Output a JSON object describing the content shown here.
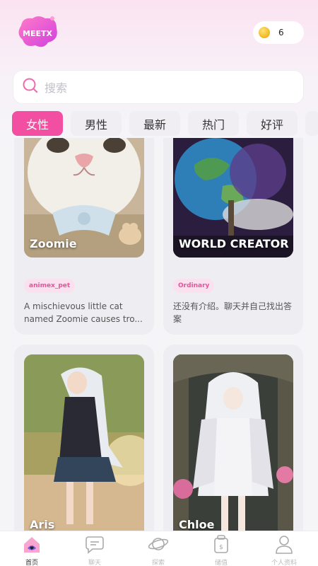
{
  "header": {
    "logo_text": "MEETX",
    "coin_count": "6"
  },
  "search": {
    "placeholder": "搜索"
  },
  "tabs": [
    {
      "label": "女性",
      "active": true
    },
    {
      "label": "男性",
      "active": false
    },
    {
      "label": "最新",
      "active": false
    },
    {
      "label": "热门",
      "active": false
    },
    {
      "label": "好评",
      "active": false
    }
  ],
  "cards": [
    {
      "title": "Zoomie",
      "tag": "animex_pet",
      "description": "A mischievous little cat named Zoomie causes tro..."
    },
    {
      "title": "WORLD CREATOR",
      "tag": "Ordinary",
      "description": "还没有介绍。聊天并自己找出答案"
    },
    {
      "title": "Aris"
    },
    {
      "title": "Chloe"
    }
  ],
  "bottom_nav": [
    {
      "label": "首页",
      "icon": "home-icon",
      "active": true
    },
    {
      "label": "聊天",
      "icon": "chat-icon",
      "active": false
    },
    {
      "label": "探索",
      "icon": "planet-icon",
      "active": false
    },
    {
      "label": "储值",
      "icon": "wallet-icon",
      "active": false
    },
    {
      "label": "个人资料",
      "icon": "profile-icon",
      "active": false
    }
  ],
  "colors": {
    "accent": "#f34fa2",
    "tag_bg": "#fbe1ef",
    "tag_text": "#e2549b"
  }
}
